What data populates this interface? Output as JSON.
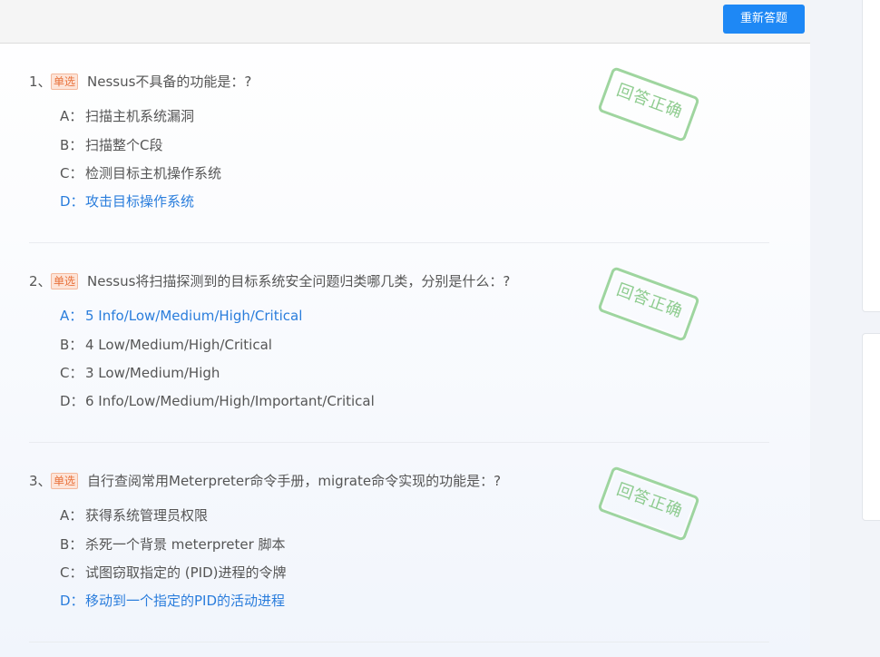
{
  "toolbar": {
    "reset_label": "重新答题"
  },
  "questions": [
    {
      "number": "1、",
      "type": "单选",
      "text": "Nessus不具备的功能是：?",
      "stamp": "回答正确",
      "options": [
        {
          "letter": "A：",
          "text": "扫描主机系统漏洞",
          "selected": false
        },
        {
          "letter": "B：",
          "text": "扫描整个C段",
          "selected": false
        },
        {
          "letter": "C：",
          "text": "检测目标主机操作系统",
          "selected": false
        },
        {
          "letter": "D：",
          "text": "攻击目标操作系统",
          "selected": true
        }
      ]
    },
    {
      "number": "2、",
      "type": "单选",
      "text": "Nessus将扫描探测到的目标系统安全问题归类哪几类，分别是什么：?",
      "stamp": "回答正确",
      "options": [
        {
          "letter": "A：",
          "text": "5 Info/Low/Medium/High/Critical",
          "selected": true
        },
        {
          "letter": "B：",
          "text": "4 Low/Medium/High/Critical",
          "selected": false
        },
        {
          "letter": "C：",
          "text": "3 Low/Medium/High",
          "selected": false
        },
        {
          "letter": "D：",
          "text": "6 Info/Low/Medium/High/Important/Critical",
          "selected": false
        }
      ]
    },
    {
      "number": "3、",
      "type": "单选",
      "text": "自行查阅常用Meterpreter命令手册，migrate命令实现的功能是：?",
      "stamp": "回答正确",
      "options": [
        {
          "letter": "A：",
          "text": "获得系统管理员权限",
          "selected": false
        },
        {
          "letter": "B：",
          "text": "杀死一个背景 meterpreter 脚本",
          "selected": false
        },
        {
          "letter": "C：",
          "text": "试图窃取指定的 (PID)进程的令牌",
          "selected": false
        },
        {
          "letter": "D：",
          "text": "移动到一个指定的PID的活动进程",
          "selected": true
        }
      ]
    }
  ],
  "colors": {
    "accent": "#1e88f5",
    "selected": "#2a7ddc",
    "stamp": "#7cc47c",
    "badge": "#e8703a"
  }
}
